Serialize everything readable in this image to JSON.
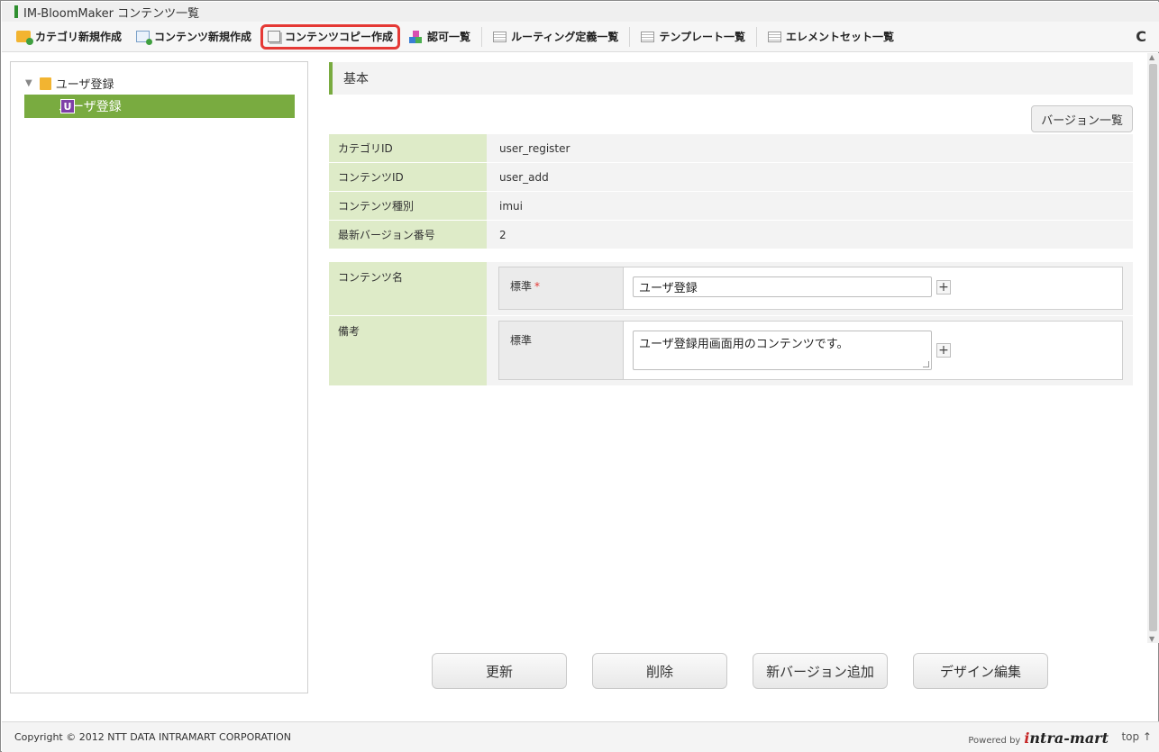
{
  "window": {
    "title": "IM-BloomMaker コンテンツ一覧"
  },
  "toolbar": {
    "items": [
      {
        "label": "カテゴリ新規作成",
        "icon": "folder-add-icon"
      },
      {
        "label": "コンテンツ新規作成",
        "icon": "document-add-icon"
      },
      {
        "label": "コンテンツコピー作成",
        "icon": "copy-icon",
        "highlighted": true
      },
      {
        "label": "認可一覧",
        "icon": "authorization-blocks-icon"
      },
      {
        "label": "ルーティング定義一覧",
        "icon": "list-icon"
      },
      {
        "label": "テンプレート一覧",
        "icon": "list-icon"
      },
      {
        "label": "エレメントセット一覧",
        "icon": "list-icon"
      }
    ],
    "reload_icon": "C"
  },
  "tree": {
    "root_label": "ユーザ登録",
    "child_label": "ユーザ登録",
    "child_badge": "U"
  },
  "section": {
    "title": "基本",
    "version_list_label": "バージョン一覧"
  },
  "info_rows": [
    {
      "label": "カテゴリID",
      "value": "user_register"
    },
    {
      "label": "コンテンツID",
      "value": "user_add"
    },
    {
      "label": "コンテンツ種別",
      "value": "imui"
    },
    {
      "label": "最新バージョン番号",
      "value": "2"
    }
  ],
  "form": {
    "content_name": {
      "label": "コンテンツ名",
      "locale_label": "標準",
      "required_mark": "*",
      "value": "ユーザ登録"
    },
    "remarks": {
      "label": "備考",
      "locale_label": "標準",
      "value": "ユーザ登録用画面用のコンテンツです。"
    },
    "plus_label": "+"
  },
  "buttons": {
    "update": "更新",
    "delete": "削除",
    "add_version": "新バージョン追加",
    "design_edit": "デザイン編集"
  },
  "footer": {
    "copyright": "Copyright © 2012 NTT DATA INTRAMART CORPORATION",
    "powered_by": "Powered by",
    "logo_text_i": "i",
    "logo_text_rest": "ntra-mart",
    "top_link": "top ↑"
  },
  "colors": {
    "accent_green": "#79ab40",
    "label_bg": "#deebc8",
    "highlight_border": "#e53935",
    "badge_purple": "#7e3fa8"
  }
}
